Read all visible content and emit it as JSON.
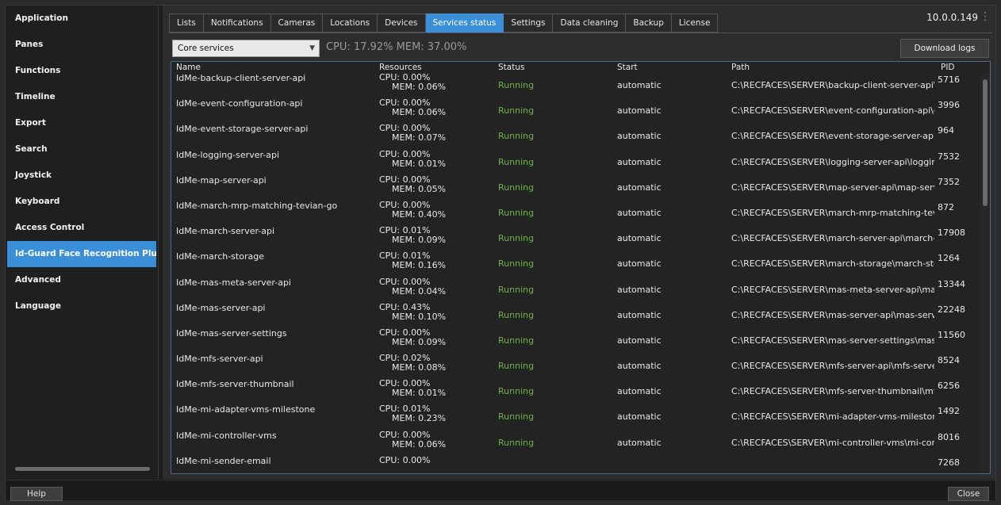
{
  "version": "10.0.0.149",
  "sidebar": {
    "items": [
      {
        "label": "Application"
      },
      {
        "label": "Panes"
      },
      {
        "label": "Functions"
      },
      {
        "label": "Timeline"
      },
      {
        "label": "Export"
      },
      {
        "label": "Search"
      },
      {
        "label": "Joystick"
      },
      {
        "label": "Keyboard"
      },
      {
        "label": "Access Control"
      },
      {
        "label": "Id-Guard Face Recognition Plugin",
        "active": true
      },
      {
        "label": "Advanced"
      },
      {
        "label": "Language"
      }
    ]
  },
  "tabs": [
    {
      "label": "Lists"
    },
    {
      "label": "Notifications"
    },
    {
      "label": "Cameras"
    },
    {
      "label": "Locations"
    },
    {
      "label": "Devices"
    },
    {
      "label": "Services status",
      "active": true
    },
    {
      "label": "Settings"
    },
    {
      "label": "Data cleaning"
    },
    {
      "label": "Backup"
    },
    {
      "label": "License"
    }
  ],
  "toolbar": {
    "service_group": "Core services",
    "cpu_mem": "CPU: 17.92% MEM: 37.00%",
    "download_label": "Download logs"
  },
  "table": {
    "headers": {
      "name": "Name",
      "resources": "Resources",
      "status": "Status",
      "start": "Start",
      "path": "Path",
      "pid": "PID"
    },
    "rows": [
      {
        "name": "IdMe-backup-client-server-api",
        "cpu": "CPU: 0.00%",
        "mem": "MEM: 0.06%",
        "status": "Running",
        "start": "automatic",
        "path": "C:\\RECFACES\\SERVER\\backup-client-server-api\\backu",
        "pid": "5716"
      },
      {
        "name": "IdMe-event-configuration-api",
        "cpu": "CPU: 0.00%",
        "mem": "MEM: 0.06%",
        "status": "Running",
        "start": "automatic",
        "path": "C:\\RECFACES\\SERVER\\event-configuration-api\\event",
        "pid": "3996"
      },
      {
        "name": "IdMe-event-storage-server-api",
        "cpu": "CPU: 0.00%",
        "mem": "MEM: 0.07%",
        "status": "Running",
        "start": "automatic",
        "path": "C:\\RECFACES\\SERVER\\event-storage-server-api\\even",
        "pid": "964"
      },
      {
        "name": "IdMe-logging-server-api",
        "cpu": "CPU: 0.00%",
        "mem": "MEM: 0.01%",
        "status": "Running",
        "start": "automatic",
        "path": "C:\\RECFACES\\SERVER\\logging-server-api\\logging-se",
        "pid": "7532"
      },
      {
        "name": "IdMe-map-server-api",
        "cpu": "CPU: 0.00%",
        "mem": "MEM: 0.05%",
        "status": "Running",
        "start": "automatic",
        "path": "C:\\RECFACES\\SERVER\\map-server-api\\map-server-ap",
        "pid": "7352"
      },
      {
        "name": "IdMe-march-mrp-matching-tevian-go",
        "cpu": "CPU: 0.00%",
        "mem": "MEM: 0.40%",
        "status": "Running",
        "start": "automatic",
        "path": "C:\\RECFACES\\SERVER\\march-mrp-matching-tevian-g",
        "pid": "872"
      },
      {
        "name": "IdMe-march-server-api",
        "cpu": "CPU: 0.01%",
        "mem": "MEM: 0.09%",
        "status": "Running",
        "start": "automatic",
        "path": "C:\\RECFACES\\SERVER\\march-server-api\\march-serve",
        "pid": "17908"
      },
      {
        "name": "IdMe-march-storage",
        "cpu": "CPU: 0.01%",
        "mem": "MEM: 0.16%",
        "status": "Running",
        "start": "automatic",
        "path": "C:\\RECFACES\\SERVER\\march-storage\\march-storage",
        "pid": "1264"
      },
      {
        "name": "IdMe-mas-meta-server-api",
        "cpu": "CPU: 0.00%",
        "mem": "MEM: 0.04%",
        "status": "Running",
        "start": "automatic",
        "path": "C:\\RECFACES\\SERVER\\mas-meta-server-api\\mas-met",
        "pid": "13344"
      },
      {
        "name": "IdMe-mas-server-api",
        "cpu": "CPU: 0.43%",
        "mem": "MEM: 0.10%",
        "status": "Running",
        "start": "automatic",
        "path": "C:\\RECFACES\\SERVER\\mas-server-api\\mas-server-api",
        "pid": "22248"
      },
      {
        "name": "IdMe-mas-server-settings",
        "cpu": "CPU: 0.00%",
        "mem": "MEM: 0.09%",
        "status": "Running",
        "start": "automatic",
        "path": "C:\\RECFACES\\SERVER\\mas-server-settings\\mas-serve",
        "pid": "11560"
      },
      {
        "name": "IdMe-mfs-server-api",
        "cpu": "CPU: 0.02%",
        "mem": "MEM: 0.08%",
        "status": "Running",
        "start": "automatic",
        "path": "C:\\RECFACES\\SERVER\\mfs-server-api\\mfs-server-api-",
        "pid": "8524"
      },
      {
        "name": "IdMe-mfs-server-thumbnail",
        "cpu": "CPU: 0.00%",
        "mem": "MEM: 0.01%",
        "status": "Running",
        "start": "automatic",
        "path": "C:\\RECFACES\\SERVER\\mfs-server-thumbnail\\mfs-serv",
        "pid": "6256"
      },
      {
        "name": "IdMe-mi-adapter-vms-milestone",
        "cpu": "CPU: 0.01%",
        "mem": "MEM: 0.23%",
        "status": "Running",
        "start": "automatic",
        "path": "C:\\RECFACES\\SERVER\\mi-adapter-vms-milestone\\mi-",
        "pid": "1492"
      },
      {
        "name": "IdMe-mi-controller-vms",
        "cpu": "CPU: 0.00%",
        "mem": "MEM: 0.06%",
        "status": "Running",
        "start": "automatic",
        "path": "C:\\RECFACES\\SERVER\\mi-controller-vms\\mi-controlle",
        "pid": "8016"
      },
      {
        "name": "IdMe-mi-sender-email",
        "cpu": "CPU: 0.00%",
        "mem": "",
        "status": "",
        "start": "",
        "path": "",
        "pid": "7268"
      }
    ]
  },
  "footer": {
    "help_label": "Help",
    "close_label": "Close"
  }
}
